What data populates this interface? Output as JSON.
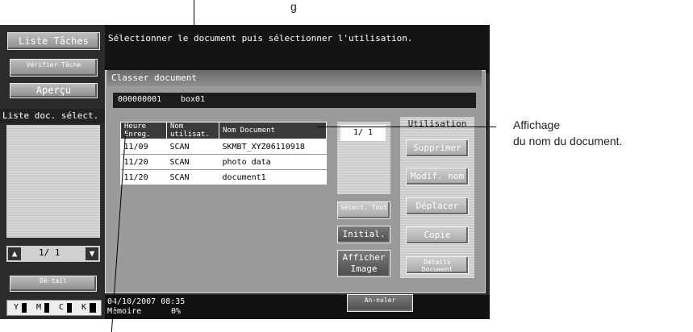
{
  "left_panel": {
    "job_list": "Liste Tâches",
    "check_job": "Vérifier Tâche",
    "preview": "Aperçu",
    "selected_docs": "Liste doc. sélect.",
    "page": "1/ 1",
    "detail": "Dé-tail",
    "toners": [
      "Y",
      "M",
      "C",
      "K"
    ]
  },
  "header": {
    "message": "Sélectionner le document puis sélectionner l'utilisation."
  },
  "dialog": {
    "title": "Classer document",
    "box_number": "000000001",
    "box_name": "box01"
  },
  "table": {
    "columns": [
      "Heure Enreg.",
      "Nom utilisat.",
      "Nom Document"
    ],
    "rows": [
      {
        "time": "11/09",
        "user": "SCAN",
        "name": "SKMBT_XYZ06110918"
      },
      {
        "time": "11/20",
        "user": "SCAN",
        "name": "photo data"
      },
      {
        "time": "11/20",
        "user": "SCAN",
        "name": "document1"
      }
    ],
    "page": "1/ 1"
  },
  "buttons": {
    "select_all": "Sélect. Tout",
    "reset": "Initial.",
    "show_image": "Afficher Image",
    "cancel": "An-nuler"
  },
  "usage": {
    "title": "Utilisation",
    "delete": "Supprimer",
    "rename": "Modif. nom",
    "move": "Déplacer",
    "copy": "Copie",
    "details": "Détails Document"
  },
  "status": {
    "datetime": "04/10/2007 08:35",
    "memory_label": "Mémoire",
    "memory_value": "0%"
  },
  "annotations": {
    "right_line1": "Affichage",
    "right_line2": "du nom du document.",
    "top_partial": "g"
  }
}
